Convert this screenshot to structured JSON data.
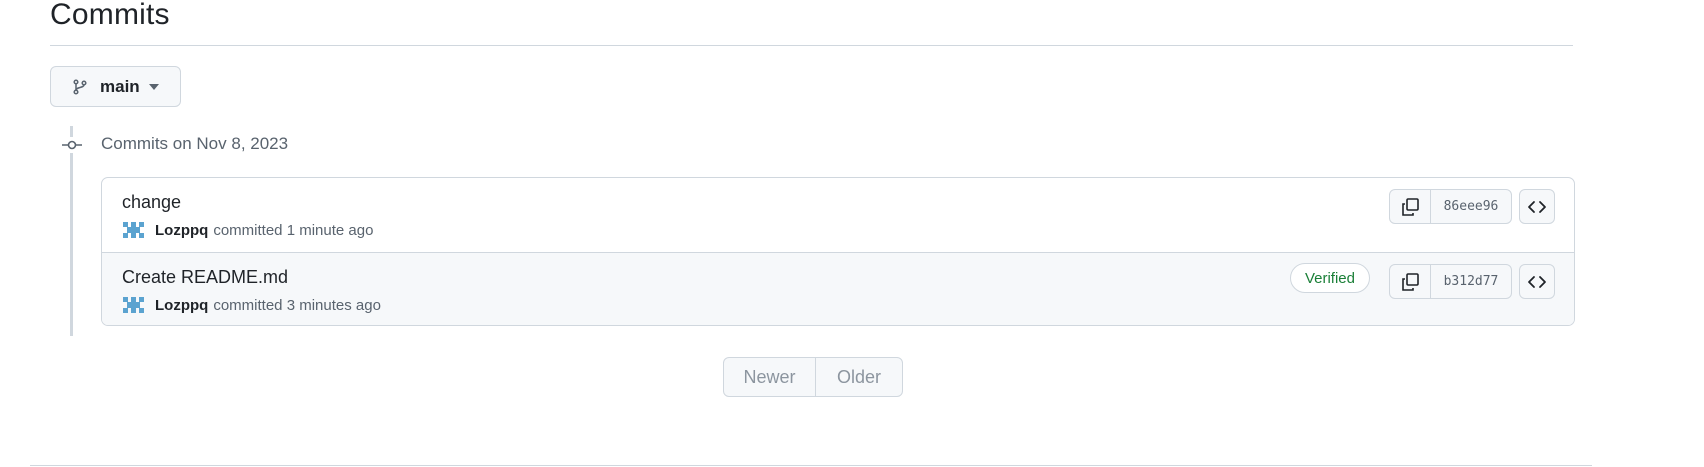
{
  "page": {
    "title": "Commits"
  },
  "branch": {
    "label": "main"
  },
  "timeline": {
    "heading": "Commits on Nov 8, 2023"
  },
  "commits": [
    {
      "message": "change",
      "author": "Lozppq",
      "action": "committed",
      "time": "1 minute ago",
      "verified": "",
      "sha": "86eee96"
    },
    {
      "message": "Create README.md",
      "author": "Lozppq",
      "action": "committed",
      "time": "3 minutes ago",
      "verified": "Verified",
      "sha": "b312d77"
    }
  ],
  "pagination": {
    "newer": "Newer",
    "older": "Older"
  },
  "colors": {
    "verified": "#1a7f37",
    "border": "#d0d7de",
    "muted": "#59636e",
    "avatar": "#5ba3d0"
  },
  "icons": [
    "git-branch-icon",
    "caret-down-icon",
    "git-commit-icon",
    "copy-icon",
    "code-icon"
  ]
}
